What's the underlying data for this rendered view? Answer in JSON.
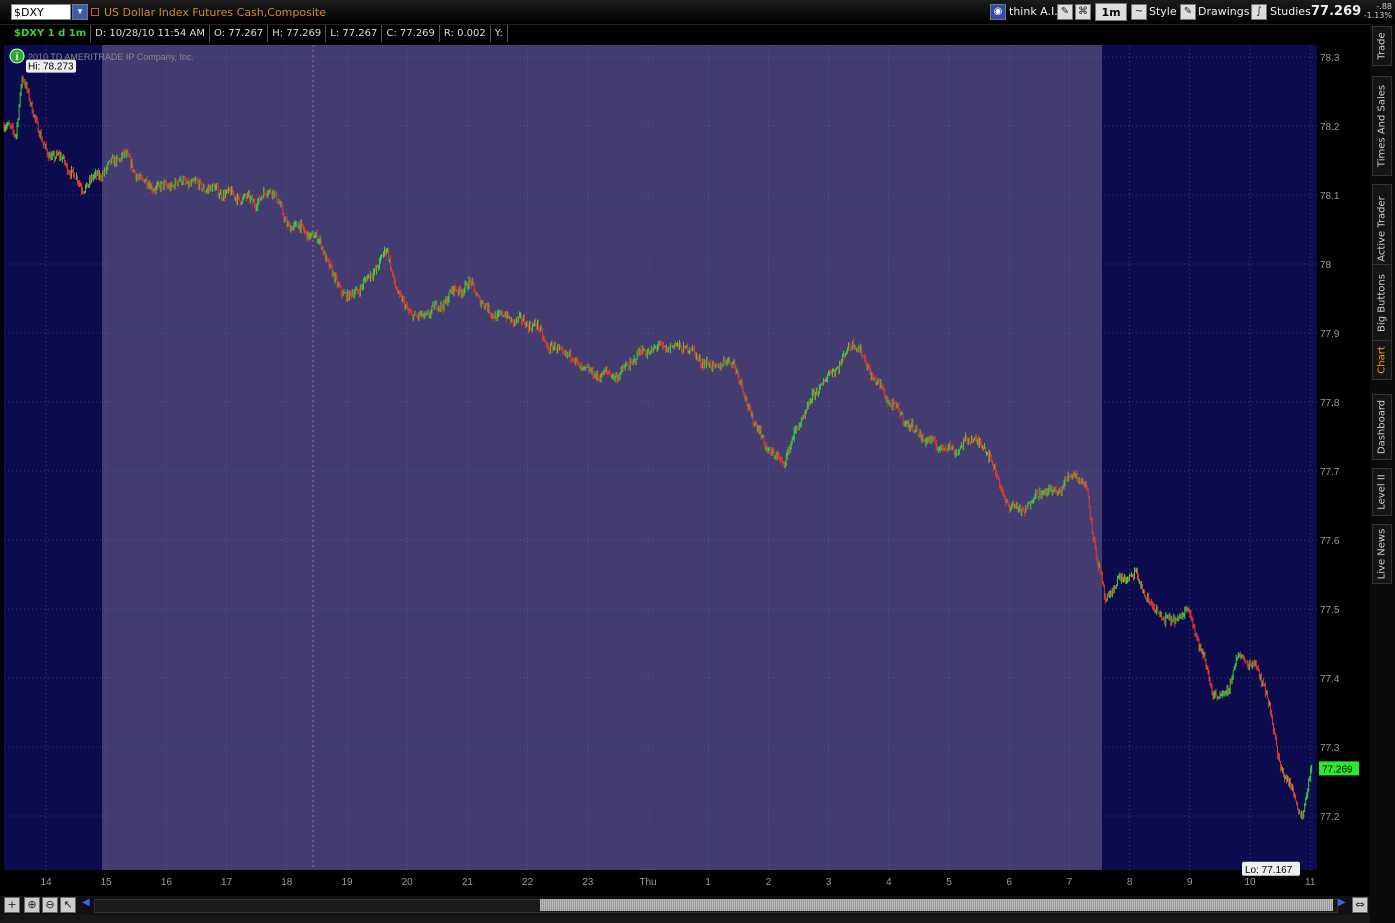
{
  "header": {
    "symbol": "$DXY",
    "description": "US Dollar Index Futures Cash,Composite",
    "think_ai": "think A.I.",
    "timeframe": "1m",
    "style_label": "Style",
    "drawings_label": "Drawings",
    "studies_label": "Studies",
    "last_price": "77.269",
    "net_change": "-.88",
    "pct_change": "-1.13%"
  },
  "infobar": {
    "symbol_label": "$DXY 1 d 1m",
    "date": "D: 10/28/10 11:54 AM",
    "open": "O: 77.267",
    "high": "H: 77.269",
    "low": "L: 77.267",
    "close": "C: 77.269",
    "range": "R: 0.002",
    "y": "Y:"
  },
  "watermark": "2010 TD AMERITRADE IP Company, Inc.",
  "sidebar": {
    "tabs": [
      "Trade",
      "Times And Sales",
      "Active Trader",
      "Big Buttons",
      "Chart",
      "Dashboard",
      "Level II",
      "Live News"
    ],
    "active": "Chart"
  },
  "colors": {
    "background": "#0b0b4d",
    "session_shade": "#433c71",
    "up": "#39d33a",
    "down": "#e23b2a",
    "axis_text": "#9a9a9a",
    "last_price_bg": "#2ee82e"
  },
  "chart_data": {
    "type": "candlestick",
    "ylim": [
      77.11,
      78.32
    ],
    "yticks": [
      "78.3",
      "78.2",
      "78.1",
      "78",
      "77.9",
      "77.8",
      "77.7",
      "77.6",
      "77.5",
      "77.4",
      "77.3",
      "77.2"
    ],
    "xticks": [
      "14",
      "15",
      "16",
      "17",
      "18",
      "19",
      "20",
      "21",
      "22",
      "23",
      "Thu",
      "1",
      "2",
      "3",
      "4",
      "5",
      "6",
      "7",
      "8",
      "9",
      "10",
      "11"
    ],
    "hi_label": "Hi: 78.273",
    "lo_label": "Lo: 77.167",
    "last_label": "77.269",
    "path": [
      [
        0,
        78.2
      ],
      [
        0.2,
        78.19
      ],
      [
        0.3,
        78.27
      ],
      [
        0.5,
        78.22
      ],
      [
        0.65,
        78.17
      ],
      [
        0.75,
        78.16
      ],
      [
        1.0,
        78.15
      ],
      [
        1.3,
        78.11
      ],
      [
        1.6,
        78.13
      ],
      [
        2.0,
        78.16
      ],
      [
        2.3,
        78.12
      ],
      [
        2.6,
        78.11
      ],
      [
        3.0,
        78.12
      ],
      [
        3.4,
        78.11
      ],
      [
        3.8,
        78.1
      ],
      [
        4.2,
        78.09
      ],
      [
        4.5,
        78.11
      ],
      [
        4.7,
        78.06
      ],
      [
        5.0,
        78.05
      ],
      [
        5.3,
        78.03
      ],
      [
        5.5,
        77.98
      ],
      [
        5.75,
        77.95
      ],
      [
        6.1,
        77.98
      ],
      [
        6.4,
        78.02
      ],
      [
        6.6,
        77.95
      ],
      [
        6.9,
        77.92
      ],
      [
        7.3,
        77.94
      ],
      [
        7.5,
        77.96
      ],
      [
        7.8,
        77.97
      ],
      [
        8.1,
        77.93
      ],
      [
        8.5,
        77.92
      ],
      [
        8.9,
        77.91
      ],
      [
        9.1,
        77.88
      ],
      [
        9.4,
        77.87
      ],
      [
        9.8,
        77.84
      ],
      [
        10.3,
        77.84
      ],
      [
        10.6,
        77.87
      ],
      [
        11.0,
        77.88
      ],
      [
        11.4,
        77.88
      ],
      [
        11.8,
        77.85
      ],
      [
        12.2,
        77.86
      ],
      [
        12.4,
        77.8
      ],
      [
        12.7,
        77.74
      ],
      [
        13.0,
        77.71
      ],
      [
        13.3,
        77.77
      ],
      [
        13.6,
        77.82
      ],
      [
        14.0,
        77.86
      ],
      [
        14.2,
        77.89
      ],
      [
        14.5,
        77.84
      ],
      [
        14.8,
        77.8
      ],
      [
        15.2,
        77.76
      ],
      [
        15.5,
        77.74
      ],
      [
        15.9,
        77.73
      ],
      [
        16.2,
        77.75
      ],
      [
        16.5,
        77.72
      ],
      [
        16.7,
        77.66
      ],
      [
        17.0,
        77.64
      ],
      [
        17.3,
        77.67
      ],
      [
        17.6,
        77.67
      ],
      [
        17.9,
        77.7
      ],
      [
        18.1,
        77.67
      ],
      [
        18.25,
        77.58
      ],
      [
        18.4,
        77.51
      ],
      [
        18.6,
        77.54
      ],
      [
        18.9,
        77.55
      ],
      [
        19.2,
        77.5
      ],
      [
        19.5,
        77.48
      ],
      [
        19.8,
        77.5
      ],
      [
        20.0,
        77.44
      ],
      [
        20.2,
        77.38
      ],
      [
        20.4,
        77.37
      ],
      [
        20.6,
        77.43
      ],
      [
        20.9,
        77.42
      ],
      [
        21.1,
        77.38
      ],
      [
        21.3,
        77.28
      ],
      [
        21.5,
        77.24
      ],
      [
        21.7,
        77.2
      ],
      [
        21.85,
        77.27
      ]
    ]
  }
}
